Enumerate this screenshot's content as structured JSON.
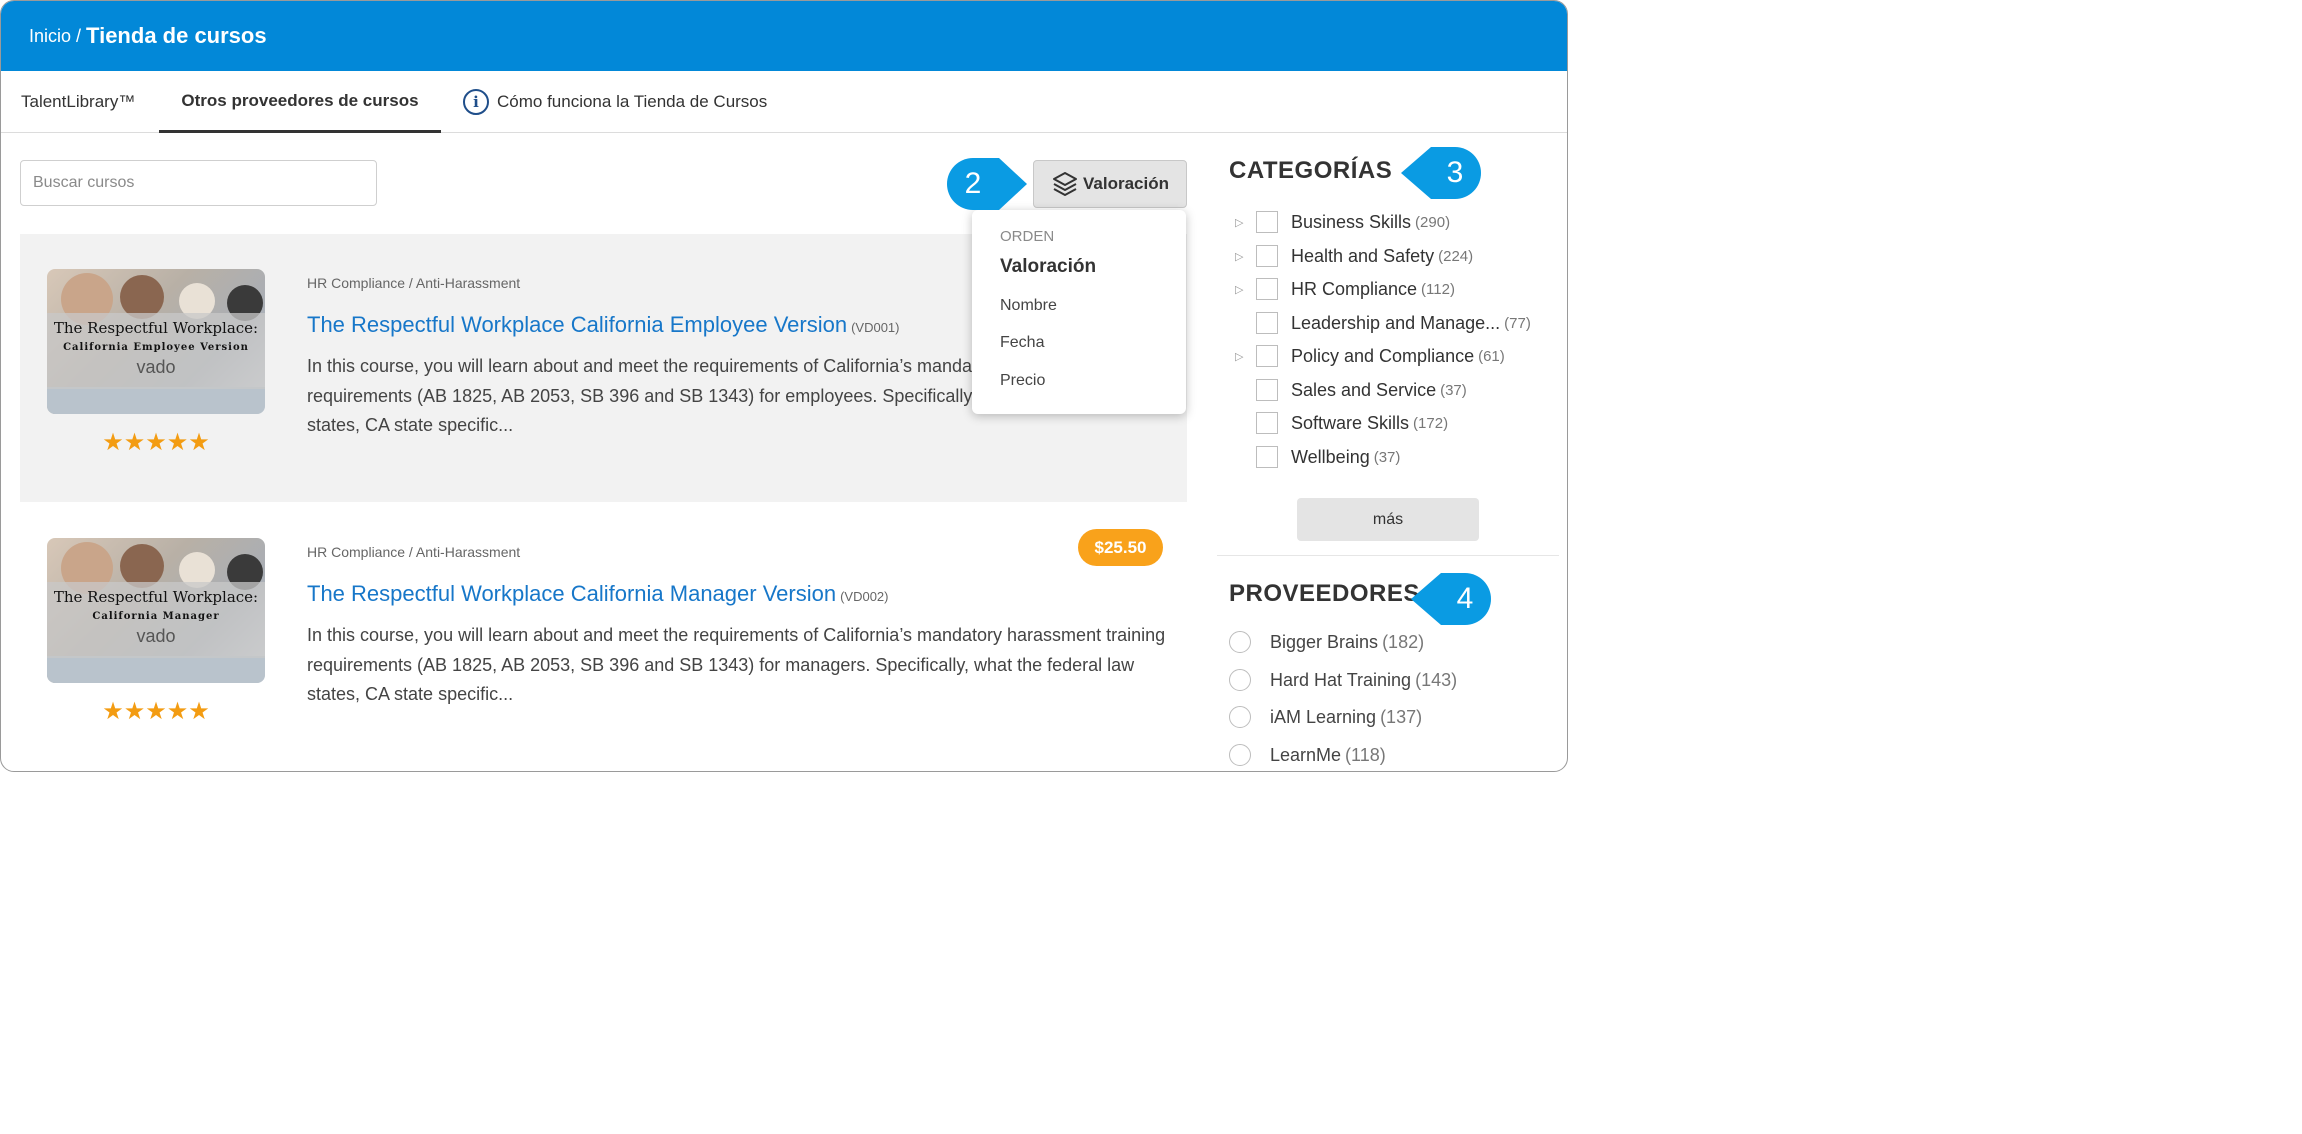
{
  "breadcrumb": {
    "home": "Inicio",
    "separator": "/",
    "current": "Tienda de cursos"
  },
  "tabs": [
    {
      "label": "TalentLibrary™",
      "active": false
    },
    {
      "label": "Otros proveedores de cursos",
      "active": true
    },
    {
      "label": "Cómo funciona la Tienda de Cursos",
      "active": false,
      "icon": "info-icon"
    }
  ],
  "search": {
    "placeholder": "Buscar cursos",
    "value": ""
  },
  "sort": {
    "button_label": "Valoración",
    "icon": "layers-icon",
    "menu_header": "ORDEN",
    "options": [
      "Valoración",
      "Nombre",
      "Fecha",
      "Precio"
    ],
    "selected": "Valoración"
  },
  "callouts": [
    "2",
    "3",
    "4"
  ],
  "courses": [
    {
      "category": "HR Compliance / Anti-Harassment",
      "title": "The Respectful Workplace California Employee Version",
      "code": "(VD001)",
      "description": "In this course, you will learn about and meet the requirements of California’s mandatory harassment training requirements (AB 1825, AB 2053, SB 396 and SB 1343) for employees. Specifically, what the federal law states, CA state specific...",
      "thumb_title": "The Respectful Workplace:",
      "thumb_sub": "California Employee Version",
      "thumb_brand": "vado",
      "rating": 5,
      "stars": "★★★★★"
    },
    {
      "category": "HR Compliance / Anti-Harassment",
      "title": "The Respectful Workplace California Manager Version",
      "code": "(VD002)",
      "description": "In this course, you will learn about and meet the requirements of California’s mandatory harassment training requirements (AB 1825, AB 2053, SB 396 and SB 1343) for managers. Specifically, what the federal law states, CA state specific...",
      "thumb_title": "The Respectful Workplace:",
      "thumb_sub": "California Manager",
      "thumb_brand": "vado",
      "rating": 5,
      "stars": "★★★★★",
      "price": "$25.50"
    }
  ],
  "categories": {
    "title": "CATEGORÍAS",
    "items": [
      {
        "label": "Business Skills",
        "count": "(290)",
        "expandable": true
      },
      {
        "label": "Health and Safety",
        "count": "(224)",
        "expandable": true
      },
      {
        "label": "HR Compliance",
        "count": "(112)",
        "expandable": true
      },
      {
        "label": "Leadership and Manage...",
        "count": "(77)",
        "expandable": false
      },
      {
        "label": "Policy and Compliance",
        "count": "(61)",
        "expandable": true
      },
      {
        "label": "Sales and Service",
        "count": "(37)",
        "expandable": false
      },
      {
        "label": "Software Skills",
        "count": "(172)",
        "expandable": false
      },
      {
        "label": "Wellbeing",
        "count": "(37)",
        "expandable": false
      }
    ],
    "more_label": "más"
  },
  "providers": {
    "title": "PROVEEDORES",
    "items": [
      {
        "label": "Bigger Brains",
        "count": "(182)"
      },
      {
        "label": "Hard Hat Training",
        "count": "(143)"
      },
      {
        "label": "iAM Learning",
        "count": "(137)"
      },
      {
        "label": "LearnMe",
        "count": "(118)"
      }
    ]
  },
  "colors": {
    "header": "#0288d8",
    "link": "#1777c9",
    "callout": "#0a9be3",
    "price": "#f9a21b",
    "star": "#f39c12"
  }
}
